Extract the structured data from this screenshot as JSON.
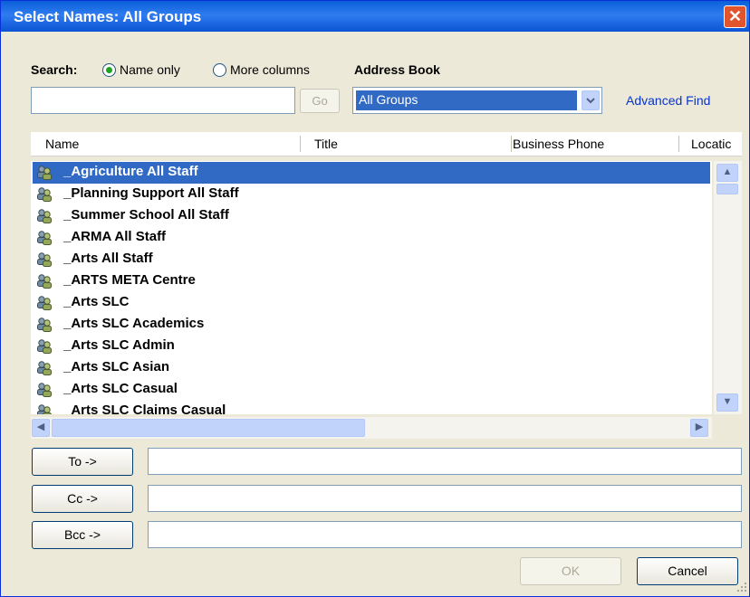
{
  "window": {
    "title": "Select Names: All Groups",
    "close_glyph": "✕"
  },
  "search": {
    "label": "Search:",
    "name_only_label": "Name only",
    "more_columns_label": "More columns",
    "selected": "name_only",
    "query": "",
    "go_label": "Go"
  },
  "address_book": {
    "label": "Address Book",
    "selected": "All Groups",
    "advanced_find_label": "Advanced Find"
  },
  "columns": [
    "Name",
    "Title",
    "Business Phone",
    "Locatic"
  ],
  "rows": [
    "_Agriculture All Staff",
    "_Planning Support All Staff",
    "_Summer School All Staff",
    "_ARMA All Staff",
    "_Arts All Staff",
    "_ARTS META Centre",
    "_Arts SLC",
    "_Arts SLC Academics",
    "_Arts SLC Admin",
    "_Arts SLC Asian",
    "_Arts SLC Casual",
    "_Arts SLC Claims Casual"
  ],
  "selected_row": 0,
  "recipients": {
    "to_label": "To ->",
    "cc_label": "Cc ->",
    "bcc_label": "Bcc ->",
    "to_value": "",
    "cc_value": "",
    "bcc_value": ""
  },
  "buttons": {
    "ok_label": "OK",
    "cancel_label": "Cancel"
  },
  "colors": {
    "selection": "#316ac5",
    "title_bar": "#0a5fd8",
    "link": "#0a34c8"
  },
  "icons": {
    "row_icon": "distribution-group-icon"
  }
}
